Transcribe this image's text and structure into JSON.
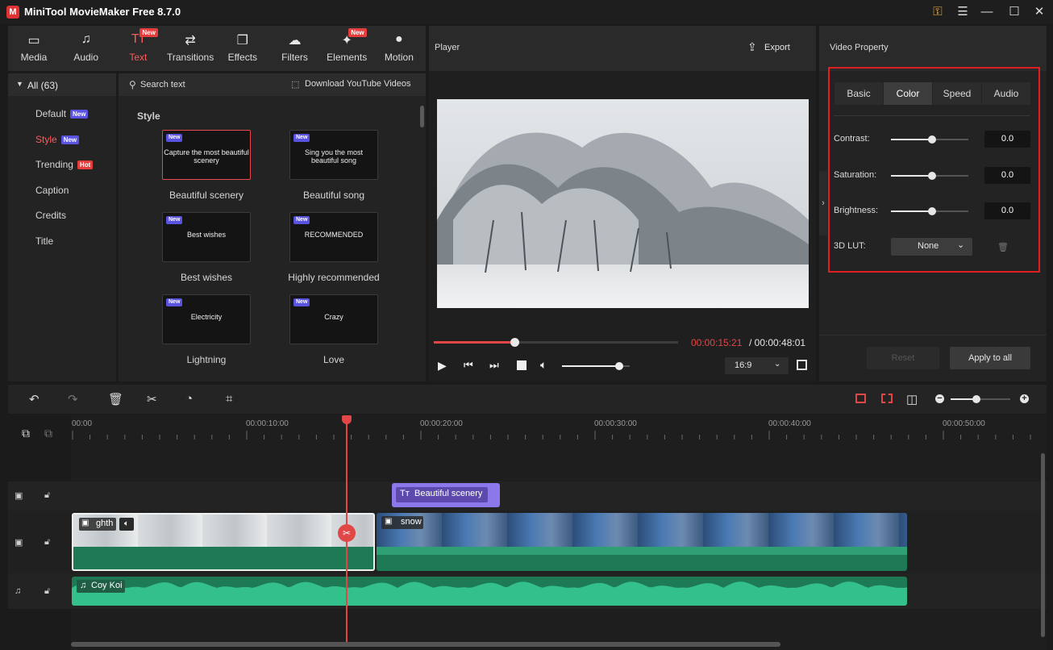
{
  "app": {
    "title": "MiniTool MovieMaker Free 8.7.0"
  },
  "tools": [
    {
      "label": "Media",
      "icon": "media-icon",
      "glyph": "▭",
      "new": false,
      "active": false
    },
    {
      "label": "Audio",
      "icon": "audio-icon",
      "glyph": "♫",
      "new": false,
      "active": false
    },
    {
      "label": "Text",
      "icon": "text-icon",
      "glyph": "Tт",
      "new": true,
      "active": true
    },
    {
      "label": "Transitions",
      "icon": "transitions-icon",
      "glyph": "⇄",
      "new": false,
      "active": false
    },
    {
      "label": "Effects",
      "icon": "effects-icon",
      "glyph": "❐",
      "new": false,
      "active": false
    },
    {
      "label": "Filters",
      "icon": "filters-icon",
      "glyph": "☁",
      "new": false,
      "active": false
    },
    {
      "label": "Elements",
      "icon": "elements-icon",
      "glyph": "✦",
      "new": true,
      "active": false
    },
    {
      "label": "Motion",
      "icon": "motion-icon",
      "glyph": "●",
      "new": false,
      "active": false
    }
  ],
  "new_badge": "New",
  "library": {
    "all": "All (63)",
    "search_placeholder": "Search text",
    "download": "Download YouTube Videos",
    "section": "Style",
    "categories": [
      {
        "label": "Default",
        "tag": "New",
        "tagType": "new"
      },
      {
        "label": "Style",
        "tag": "New",
        "tagType": "new",
        "active": true
      },
      {
        "label": "Trending",
        "tag": "Hot",
        "tagType": "hot"
      },
      {
        "label": "Caption"
      },
      {
        "label": "Credits"
      },
      {
        "label": "Title"
      }
    ],
    "cards": [
      {
        "label": "Beautiful scenery",
        "art": "Capture the most beautiful scenery",
        "selected": true
      },
      {
        "label": "Beautiful song",
        "art": "Sing you the most beautiful song"
      },
      {
        "label": "Best wishes",
        "art": "Best wishes"
      },
      {
        "label": "Highly recommended",
        "art": "RECOMMENDED"
      },
      {
        "label": "Lightning",
        "art": "Electricity"
      },
      {
        "label": "Love",
        "art": "Crazy"
      }
    ]
  },
  "player": {
    "title": "Player",
    "export": "Export",
    "current_time": "00:00:15:21",
    "total_time": "/ 00:00:48:01",
    "progress": 0.33,
    "volume": 0.85,
    "ratio": "16:9"
  },
  "property": {
    "title": "Video Property",
    "tabs": [
      "Basic",
      "Color",
      "Speed",
      "Audio"
    ],
    "active_tab": "Color",
    "rows": [
      {
        "label": "Contrast:",
        "value": "0.0",
        "level": 0.5
      },
      {
        "label": "Saturation:",
        "value": "0.0",
        "level": 0.5
      },
      {
        "label": "Brightness:",
        "value": "0.0",
        "level": 0.5
      }
    ],
    "lut_label": "3D LUT:",
    "lut_value": "None",
    "reset": "Reset",
    "apply_all": "Apply to all",
    "highlight_color": "#e02020"
  },
  "timeline": {
    "ruler": [
      "00:00",
      "00:00:10:00",
      "00:00:20:00",
      "00:00:30:00",
      "00:00:40:00",
      "00:00:50:00"
    ],
    "text_clip": "Beautiful scenery",
    "video_clip1": "ghth",
    "video_clip2": "snow",
    "audio_clip": "Coy Koi",
    "playhead_color": "#e24747"
  }
}
